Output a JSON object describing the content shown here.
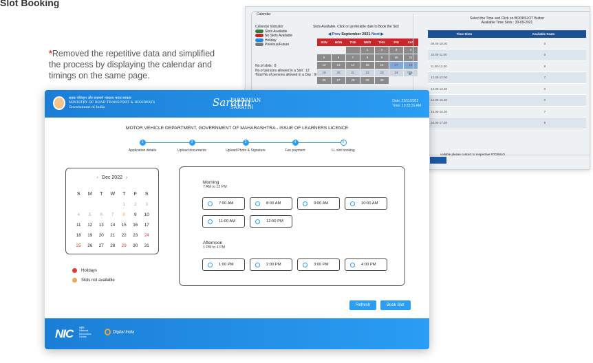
{
  "heading": "Slot Booking",
  "note": {
    "asterisk": "*",
    "text": "Removed the repetitive data and simplified the process by displaying the calendar and timings on the same page."
  },
  "old": {
    "legend_title": "Calendar",
    "indicator_title": "Calendar Indicator",
    "indicators": [
      {
        "label": "Slots Available",
        "color": "#2e7d32"
      },
      {
        "label": "No Slots Available",
        "color": "#c62828"
      },
      {
        "label": "Holiday",
        "color": "#1e88e5"
      },
      {
        "label": "Previous/Future",
        "color": "#777777"
      }
    ],
    "stats": [
      "No.of slots : 8",
      "No.of persons allowed in a Slot : 12",
      "Total No.of persons allowed in a Day : 96"
    ],
    "slots_note": "Slots Available. Click on preferable date to Book the Slot",
    "prev": "◀ Prev",
    "month": "September 2021",
    "next": "Next ▶",
    "weekdays": [
      "SUN",
      "MON",
      "TUE",
      "WED",
      "THU",
      "FRI",
      "SAT"
    ],
    "right_note": [
      "Select the Time and Click on BOOKSLOT Button",
      "Available Time Slots : 30-09-2021"
    ],
    "table_headers": [
      "Time Slots",
      "Available Seats"
    ],
    "rows": [
      [
        "09.00-10.00",
        "0"
      ],
      [
        "10.00-11.00",
        "0"
      ],
      [
        "11.00-12.00",
        "8"
      ],
      [
        "12.00-13.00",
        "7"
      ],
      [
        "13.30-14.30",
        "0"
      ],
      [
        "14.30-15.30",
        "0"
      ],
      [
        "15.30-16.30",
        "7"
      ],
      [
        "16.30-17.30",
        "8"
      ]
    ],
    "footnote": "vailable please contact to respective RTO/MLO"
  },
  "header": {
    "ministry": [
      "सड़क परिवहन और राजमार्ग मंत्रालय भारत सरकार",
      "MINISTRY OF ROAD TRANSPORT & HIGHWAYS",
      "Government of India"
    ],
    "logo_big": "Sarathi",
    "logo_words": [
      "PARIVAHAN",
      "SARATHI"
    ],
    "date": "Date: 22/11/2022",
    "time": "Time: 10:33:31 AM"
  },
  "title": "MOTOR VEHICLE DEPARTMENT, GOVERNMENT OF MAHARASHTRA - ISSUE OF LEARNERS LICENCE",
  "steps": [
    {
      "n": "1",
      "label": "Application details"
    },
    {
      "n": "2",
      "label": "Upload documents"
    },
    {
      "n": "3",
      "label": "Upload Photo & Signature"
    },
    {
      "n": "4",
      "label": "Fee payment"
    },
    {
      "n": "5",
      "label": "LL slot booking"
    }
  ],
  "calendar": {
    "prev": "‹",
    "month": "Dec 2022",
    "next": "›",
    "weekdays": [
      "S",
      "M",
      "T",
      "W",
      "T",
      "F",
      "S"
    ]
  },
  "legend": [
    {
      "label": "Holidays",
      "color": "#e53935"
    },
    {
      "label": "Slots not available",
      "color": "#f2a35c"
    }
  ],
  "morning": {
    "title": "Morning",
    "range": "7 AM to 12 PM",
    "slots": [
      "7:00 AM",
      "8:00 AM",
      "9:00 AM",
      "10:00 AM",
      "11:00 AM",
      "12:00 PM"
    ]
  },
  "afternoon": {
    "title": "Afternoon",
    "range": "1 PM to 4 PM",
    "slots": [
      "1:00 PM",
      "2:00 PM",
      "3:00 PM",
      "4:00 PM"
    ]
  },
  "actions": {
    "refresh": "Refresh",
    "book": "Book Slot"
  },
  "footer": {
    "nic": "NIC",
    "nic_sub": [
      "राष्ट्रीय",
      "National",
      "Informatics",
      "Centre"
    ],
    "digital": "Digital India"
  }
}
